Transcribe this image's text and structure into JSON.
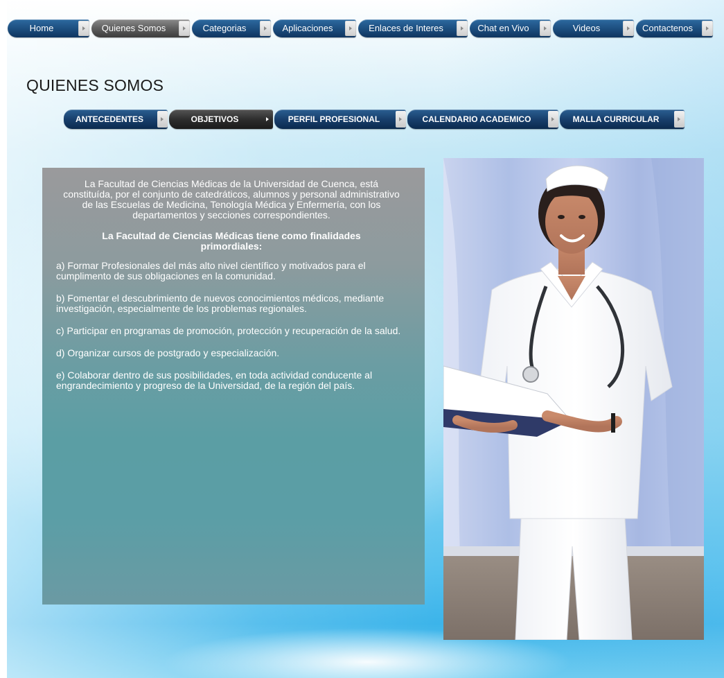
{
  "top_nav": {
    "items": [
      {
        "label": "Home",
        "active": false
      },
      {
        "label": "Quienes Somos",
        "active": true
      },
      {
        "label": "Categorias",
        "active": false
      },
      {
        "label": "Aplicaciones",
        "active": false
      },
      {
        "label": "Enlaces de Interes",
        "active": false
      },
      {
        "label": "Chat en Vivo",
        "active": false
      },
      {
        "label": "Videos",
        "active": false
      },
      {
        "label": "Contactenos",
        "active": false
      }
    ]
  },
  "page_title": "QUIENES SOMOS",
  "sub_nav": {
    "items": [
      {
        "label": "ANTECEDENTES",
        "active": false
      },
      {
        "label": "OBJETIVOS",
        "active": true
      },
      {
        "label": "PERFIL PROFESIONAL",
        "active": false
      },
      {
        "label": "CALENDARIO ACADEMICO",
        "active": false
      },
      {
        "label": "MALLA CURRICULAR",
        "active": false
      }
    ]
  },
  "content": {
    "intro": "La Facultad de Ciencias Médicas de la Universidad de Cuenca, está constituída, por el conjunto de catedráticos, alumnos y personal administrativo de las Escuelas de Medicina, Tenología Médica y Enfermería, con los departamentos y secciones correspondientes.",
    "headline": "La Facultad de Ciencias Médicas tiene como finalidades primordiales:",
    "items": [
      "a) Formar Profesionales del más alto nivel científico y motivados para el cumplimento de sus obligaciones en la comunidad.",
      "b) Fomentar el descubrimiento de nuevos conocimientos médicos, mediante investigación, especialmente de los problemas regionales.",
      "c) Participar en programas de promoción, protección y recuperación de la salud.",
      "d) Organizar cursos de postgrado y especialización.",
      "e) Colaborar dentro de sus posibilidades, en toda actividad conducente al engrandecimiento y progreso de la Universidad, de la región del país."
    ]
  },
  "colors": {
    "nav_blue": "#1d4f80",
    "nav_active_gray": "#5e5e5e",
    "panel_teal": "#5b9ea4",
    "background_sky": "#8fd6f1"
  },
  "icons": {
    "nav_arrow": "chevron-right-icon"
  }
}
